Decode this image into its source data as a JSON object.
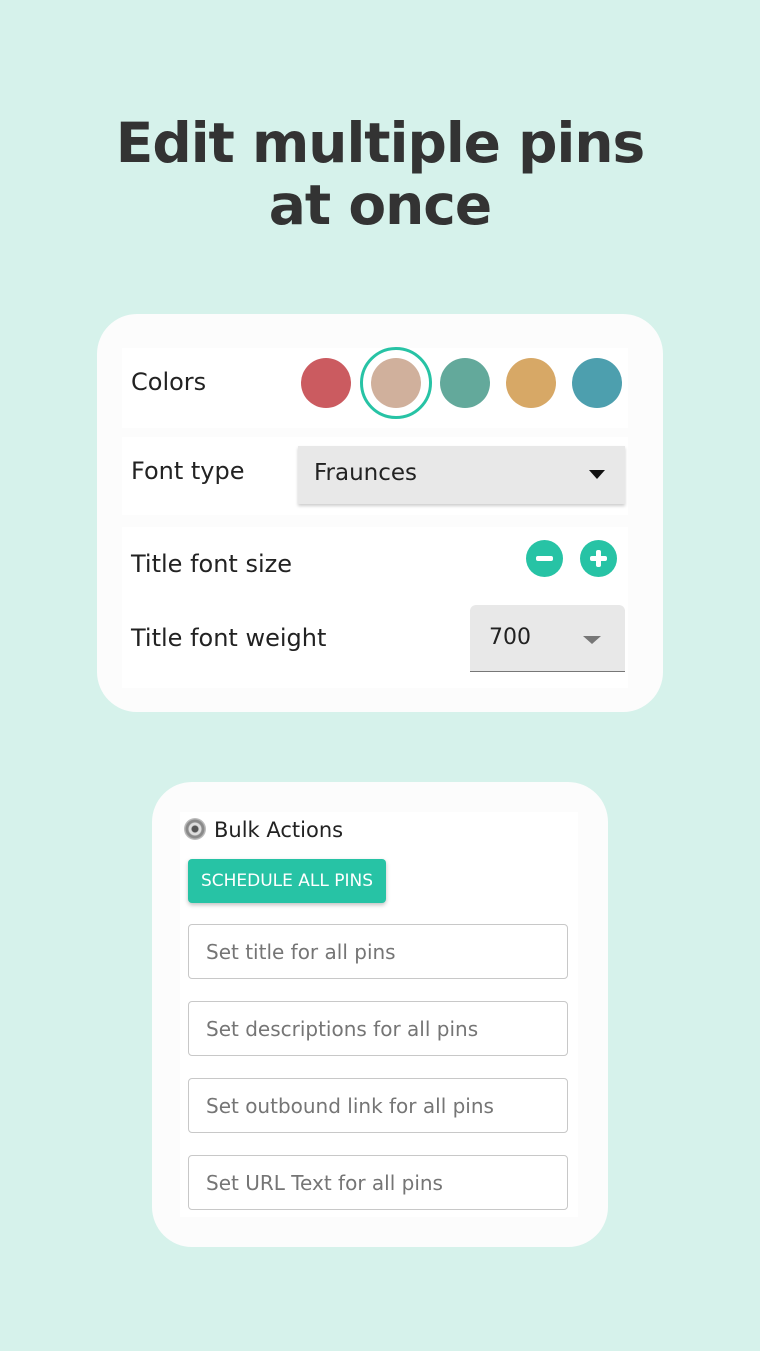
{
  "headline": {
    "line1": "Edit multiple pins",
    "line2": "at once"
  },
  "style_card": {
    "colors_label": "Colors",
    "swatches": [
      {
        "color": "#cb5b60",
        "selected": false
      },
      {
        "color": "#d0b09c",
        "selected": true
      },
      {
        "color": "#63a99b",
        "selected": false
      },
      {
        "color": "#d7a866",
        "selected": false
      },
      {
        "color": "#4d9fae",
        "selected": false
      }
    ],
    "accent": "#27c3a5",
    "font_type_label": "Font type",
    "font_type_value": "Fraunces",
    "title_font_size_label": "Title font size",
    "title_font_weight_label": "Title font weight",
    "title_font_weight_value": "700"
  },
  "bulk": {
    "title": "Bulk Actions",
    "icon": "gear-icon",
    "schedule_button": "SCHEDULE ALL PINS",
    "inputs": [
      {
        "placeholder": "Set title for all pins"
      },
      {
        "placeholder": "Set descriptions for all pins"
      },
      {
        "placeholder": "Set outbound link for all pins"
      },
      {
        "placeholder": "Set URL Text for all pins"
      }
    ]
  }
}
